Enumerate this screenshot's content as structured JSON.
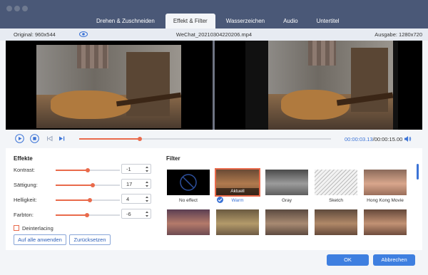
{
  "window": {
    "accent": "#3e7fe0",
    "slider_color": "#e96a4b"
  },
  "tabs": [
    {
      "label": "Drehen & Zuschneiden",
      "active": false
    },
    {
      "label": "Effekt & Filter",
      "active": true
    },
    {
      "label": "Wasserzeichen",
      "active": false
    },
    {
      "label": "Audio",
      "active": false
    },
    {
      "label": "Untertitel",
      "active": false
    }
  ],
  "infobar": {
    "original": "Original: 960x544",
    "filename": "WeChat_20210304220206.mp4",
    "output": "Ausgabe: 1280x720"
  },
  "playback": {
    "current_time": "00:00:03.13",
    "total_time": "/00:00:15.00",
    "progress": 0.24
  },
  "effects": {
    "title": "Effekte",
    "rows": [
      {
        "label": "Kontrast:",
        "value": "-1",
        "level": 0.5
      },
      {
        "label": "Sättigung:",
        "value": "17",
        "level": 0.58
      },
      {
        "label": "Helligkeit:",
        "value": "4",
        "level": 0.53
      },
      {
        "label": "Farbton:",
        "value": "-6",
        "level": 0.49
      }
    ],
    "deinterlacing": "Deinterlacing",
    "apply_all": "Auf alle anwenden",
    "reset": "Zurücksetzen"
  },
  "filter": {
    "title": "Filter",
    "items": [
      {
        "label": "No effect",
        "selected": false
      },
      {
        "label": "Warm",
        "selected": true,
        "badge": "Aktuell"
      },
      {
        "label": "Gray",
        "selected": false
      },
      {
        "label": "Sketch",
        "selected": false
      },
      {
        "label": "Hong Kong Movie",
        "selected": false
      }
    ]
  },
  "buttons": {
    "ok": "OK",
    "cancel": "Abbrechen"
  }
}
